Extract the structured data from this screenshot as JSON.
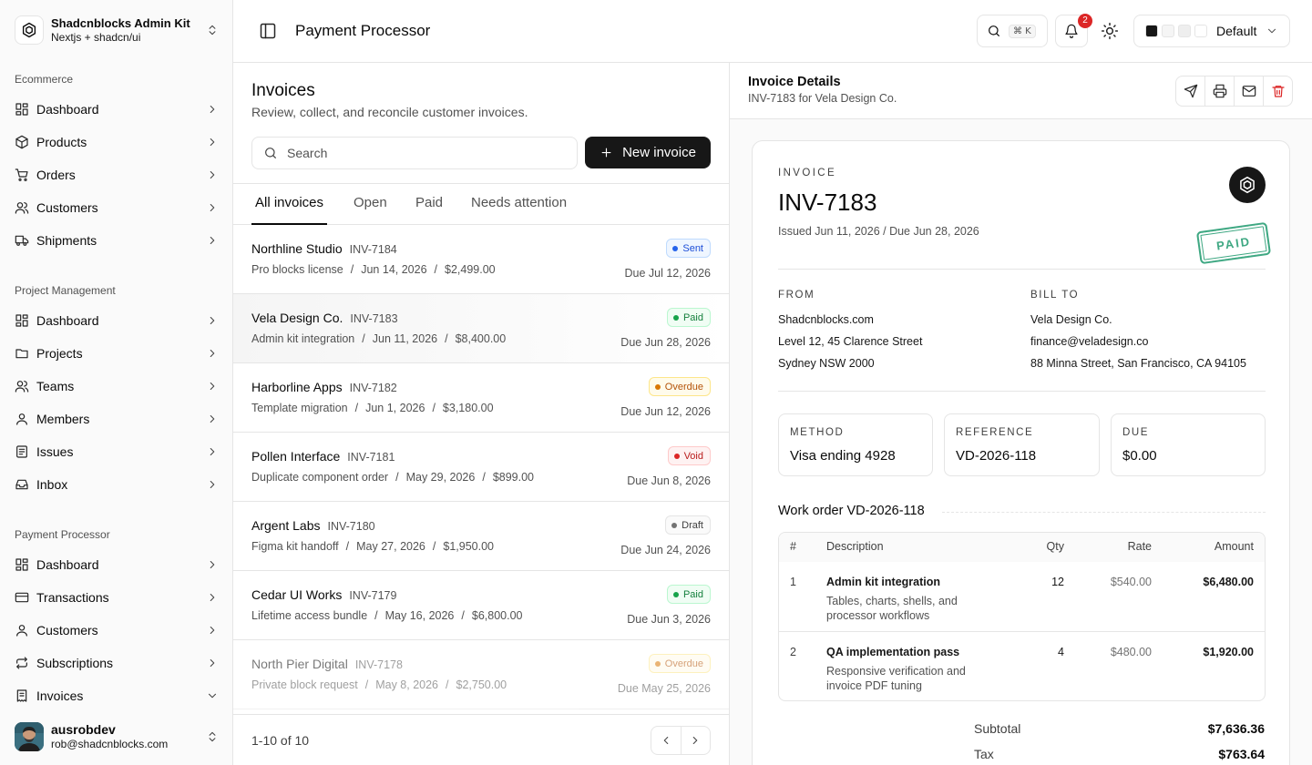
{
  "colors": {
    "accent": "#171717",
    "paid": "#16a34a",
    "overdue": "#d97706",
    "void": "#dc2626",
    "draft": "#737373",
    "sent": "#2563eb"
  },
  "sidebar": {
    "brand": {
      "title": "Shadcnblocks Admin Kit",
      "subtitle": "Nextjs + shadcn/ui"
    },
    "groups": [
      {
        "label": "Ecommerce",
        "items": [
          {
            "label": "Dashboard",
            "icon": "dashboard-icon"
          },
          {
            "label": "Products",
            "icon": "package-icon"
          },
          {
            "label": "Orders",
            "icon": "cart-icon"
          },
          {
            "label": "Customers",
            "icon": "users-icon"
          },
          {
            "label": "Shipments",
            "icon": "truck-icon"
          }
        ]
      },
      {
        "label": "Project Management",
        "items": [
          {
            "label": "Dashboard",
            "icon": "dashboard-icon"
          },
          {
            "label": "Projects",
            "icon": "folder-icon"
          },
          {
            "label": "Teams",
            "icon": "users-icon"
          },
          {
            "label": "Members",
            "icon": "user-icon"
          },
          {
            "label": "Issues",
            "icon": "list-icon"
          },
          {
            "label": "Inbox",
            "icon": "inbox-icon"
          }
        ]
      },
      {
        "label": "Payment Processor",
        "items": [
          {
            "label": "Dashboard",
            "icon": "dashboard-icon"
          },
          {
            "label": "Transactions",
            "icon": "credit-card-icon"
          },
          {
            "label": "Customers",
            "icon": "user-icon"
          },
          {
            "label": "Subscriptions",
            "icon": "repeat-icon"
          },
          {
            "label": "Invoices",
            "icon": "receipt-icon",
            "expanded": true
          }
        ]
      }
    ],
    "user": {
      "name": "ausrobdev",
      "email": "rob@shadcnblocks.com"
    }
  },
  "header": {
    "title": "Payment Processor",
    "search_shortcut": "⌘ K",
    "notification_count": "2",
    "theme": {
      "label": "Default",
      "swatches": [
        "#171717",
        "#f5f5f5",
        "#eeeeee",
        "#ffffff"
      ]
    }
  },
  "list": {
    "title": "Invoices",
    "subtitle": "Review, collect, and reconcile customer invoices.",
    "search_placeholder": "Search",
    "new_button": "New invoice",
    "tabs": [
      "All invoices",
      "Open",
      "Paid",
      "Needs attention"
    ],
    "invoices": [
      {
        "name": "Northline Studio",
        "id": "INV-7184",
        "item": "Pro blocks license",
        "date": "Jun 14, 2026",
        "amount": "$2,499.00",
        "status": "Sent",
        "due": "Due Jul 12, 2026"
      },
      {
        "name": "Vela Design Co.",
        "id": "INV-7183",
        "item": "Admin kit integration",
        "date": "Jun 11, 2026",
        "amount": "$8,400.00",
        "status": "Paid",
        "due": "Due Jun 28, 2026",
        "selected": true
      },
      {
        "name": "Harborline Apps",
        "id": "INV-7182",
        "item": "Template migration",
        "date": "Jun 1, 2026",
        "amount": "$3,180.00",
        "status": "Overdue",
        "due": "Due Jun 12, 2026"
      },
      {
        "name": "Pollen Interface",
        "id": "INV-7181",
        "item": "Duplicate component order",
        "date": "May 29, 2026",
        "amount": "$899.00",
        "status": "Void",
        "due": "Due Jun 8, 2026"
      },
      {
        "name": "Argent Labs",
        "id": "INV-7180",
        "item": "Figma kit handoff",
        "date": "May 27, 2026",
        "amount": "$1,950.00",
        "status": "Draft",
        "due": "Due Jun 24, 2026"
      },
      {
        "name": "Cedar UI Works",
        "id": "INV-7179",
        "item": "Lifetime access bundle",
        "date": "May 16, 2026",
        "amount": "$6,800.00",
        "status": "Paid",
        "due": "Due Jun 3, 2026"
      },
      {
        "name": "North Pier Digital",
        "id": "INV-7178",
        "item": "Private block request",
        "date": "May 8, 2026",
        "amount": "$2,750.00",
        "status": "Overdue",
        "due": "Due May 25, 2026"
      }
    ],
    "pagination": "1-10 of 10"
  },
  "details": {
    "title": "Invoice Details",
    "subtitle": "INV-7183 for Vela Design Co.",
    "kicker": "INVOICE",
    "number": "INV-7183",
    "dates": "Issued Jun 11, 2026 / Due Jun 28, 2026",
    "stamp": "PAID",
    "from_label": "FROM",
    "from": [
      "Shadcnblocks.com",
      "Level 12, 45 Clarence Street",
      "Sydney NSW 2000"
    ],
    "bill_label": "BILL TO",
    "bill_to": [
      "Vela Design Co.",
      "finance@veladesign.co",
      "88 Minna Street, San Francisco, CA 94105"
    ],
    "boxes": [
      {
        "label": "METHOD",
        "value": "Visa ending 4928"
      },
      {
        "label": "REFERENCE",
        "value": "VD-2026-118"
      },
      {
        "label": "DUE",
        "value": "$0.00"
      }
    ],
    "work_order": "Work order VD-2026-118",
    "table": {
      "headers": [
        "#",
        "Description",
        "Qty",
        "Rate",
        "Amount"
      ],
      "rows": [
        {
          "n": "1",
          "title": "Admin kit integration",
          "desc": "Tables, charts, shells, and processor workflows",
          "qty": "12",
          "rate": "$540.00",
          "amount": "$6,480.00"
        },
        {
          "n": "2",
          "title": "QA implementation pass",
          "desc": "Responsive verification and invoice PDF tuning",
          "qty": "4",
          "rate": "$480.00",
          "amount": "$1,920.00"
        }
      ]
    },
    "totals": [
      {
        "label": "Subtotal",
        "value": "$7,636.36"
      },
      {
        "label": "Tax",
        "value": "$763.64"
      }
    ]
  }
}
